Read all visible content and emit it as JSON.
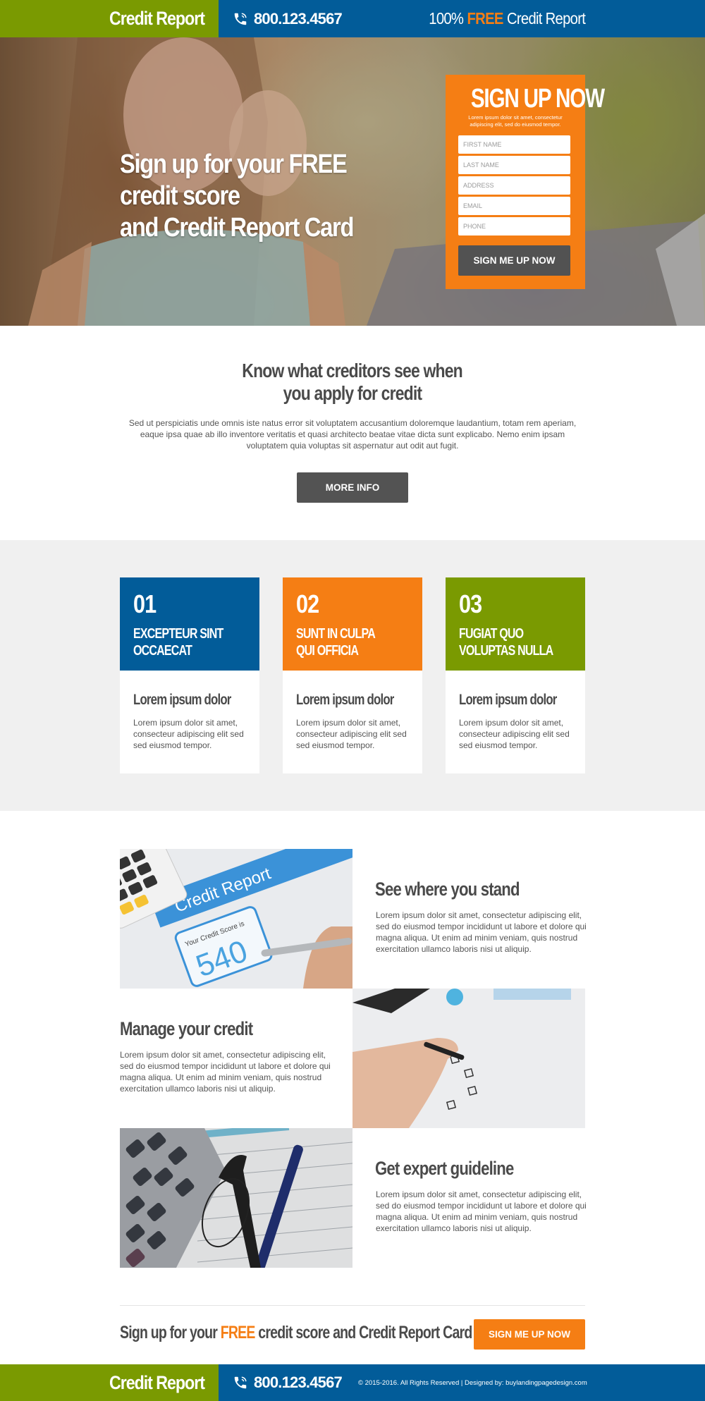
{
  "header": {
    "logo": "Credit Report",
    "phone": "800.123.4567",
    "banner_prefix": "100%",
    "banner_highlight": "FREE",
    "banner_suffix": "Credit Report"
  },
  "hero": {
    "headline_line1": "Sign up for your FREE credit score",
    "headline_line2": "and Credit Report Card"
  },
  "signup_form": {
    "title": "SIGN UP NOW",
    "subtitle": "Lorem ipsum dolor sit amet, consectetur adipiscing elit, sed do eiusmod tempor.",
    "fields": [
      {
        "placeholder": "FIRST NAME",
        "value": ""
      },
      {
        "placeholder": "LAST NAME",
        "value": ""
      },
      {
        "placeholder": "ADDRESS",
        "value": ""
      },
      {
        "placeholder": "EMAIL",
        "value": ""
      },
      {
        "placeholder": "PHONE",
        "value": ""
      }
    ],
    "submit_label": "SIGN ME UP NOW"
  },
  "intro": {
    "title_line1": "Know what creditors see when",
    "title_line2": "you apply for credit",
    "text": "Sed ut perspiciatis unde omnis iste natus error sit voluptatem accusantium doloremque laudantium, totam rem aperiam, eaque ipsa quae ab illo inventore veritatis et quasi architecto beatae vitae dicta sunt explicabo. Nemo enim ipsam voluptatem quia voluptas sit aspernatur aut odit aut fugit.",
    "button_label": "MORE INFO"
  },
  "cards": [
    {
      "number": "01",
      "title": "EXCEPTEUR SINT\nOCCAECAT",
      "body_title": "Lorem ipsum dolor",
      "body_text": "Lorem ipsum dolor sit amet, consecteur adipiscing elit sed sed eiusmod tempor.",
      "color": "#025c99"
    },
    {
      "number": "02",
      "title": "SUNT IN CULPA\nQUI OFFICIA",
      "body_title": "Lorem ipsum dolor",
      "body_text": "Lorem ipsum dolor sit amet, consecteur adipiscing elit sed sed eiusmod tempor.",
      "color": "#f57e14"
    },
    {
      "number": "03",
      "title": " FUGIAT QUO\nVOLUPTAS NULLA",
      "body_title": "Lorem ipsum dolor",
      "body_text": "Lorem ipsum dolor sit amet, consecteur adipiscing elit sed sed eiusmod tempor.",
      "color": "#7a9a01"
    }
  ],
  "features": [
    {
      "title": "See where you stand",
      "text": "Lorem ipsum dolor sit amet, consectetur adipiscing elit, sed do eiusmod tempor incididunt ut labore et dolore qui magna aliqua. Ut enim ad minim veniam, quis nostrud exercitation ullamco laboris nisi ut aliquip.",
      "image": {
        "label": "Credit Report",
        "score_label": "Your Credit Score is",
        "score": "540"
      }
    },
    {
      "title": "Manage your credit",
      "text": "Lorem ipsum dolor sit amet, consectetur adipiscing elit, sed do eiusmod tempor incididunt ut labore et dolore qui magna aliqua. Ut enim ad minim veniam, quis nostrud exercitation ullamco laboris nisi ut aliquip."
    },
    {
      "title": "Get expert guideline",
      "text": "Lorem ipsum dolor sit amet, consectetur adipiscing elit, sed do eiusmod tempor incididunt ut labore et dolore qui magna aliqua. Ut enim ad minim veniam, quis nostrud exercitation ullamco laboris nisi ut aliquip."
    }
  ],
  "cta": {
    "text_prefix": "Sign up for your",
    "text_highlight": "FREE",
    "text_suffix": "credit score and Credit Report Card",
    "button_label": "SIGN ME UP NOW"
  },
  "footer": {
    "logo": "Credit Report",
    "phone": "800.123.4567",
    "copyright": "© 2015-2016. All Rights Reserved  |  Designed by: buylandingpagedesign.com"
  },
  "colors": {
    "green": "#7a9a01",
    "blue": "#025c99",
    "orange": "#f57e14",
    "dark_button": "#535353"
  }
}
